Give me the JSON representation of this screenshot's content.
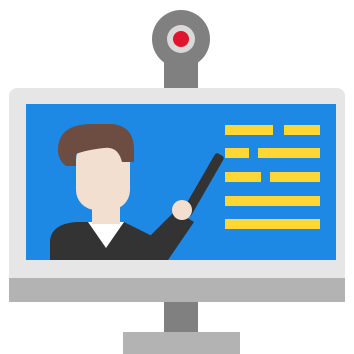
{
  "icon": {
    "name": "online-teaching-monitor-icon",
    "colors": {
      "monitor_body": "#e6e6e6",
      "monitor_bezel_bottom": "#b3b3b3",
      "screen": "#1e88e5",
      "webcam_body": "#808080",
      "webcam_lens": "#e0142b",
      "webcam_ring": "#d9d9d9",
      "stand_neck": "#808080",
      "stand_base": "#b3b3b3",
      "text_lines": "#fdd835",
      "teacher_hair": "#6d4c41",
      "teacher_skin": "#f3dfd0",
      "teacher_shirt": "#333333",
      "teacher_collar": "#ffffff",
      "pointer": "#333333"
    }
  }
}
